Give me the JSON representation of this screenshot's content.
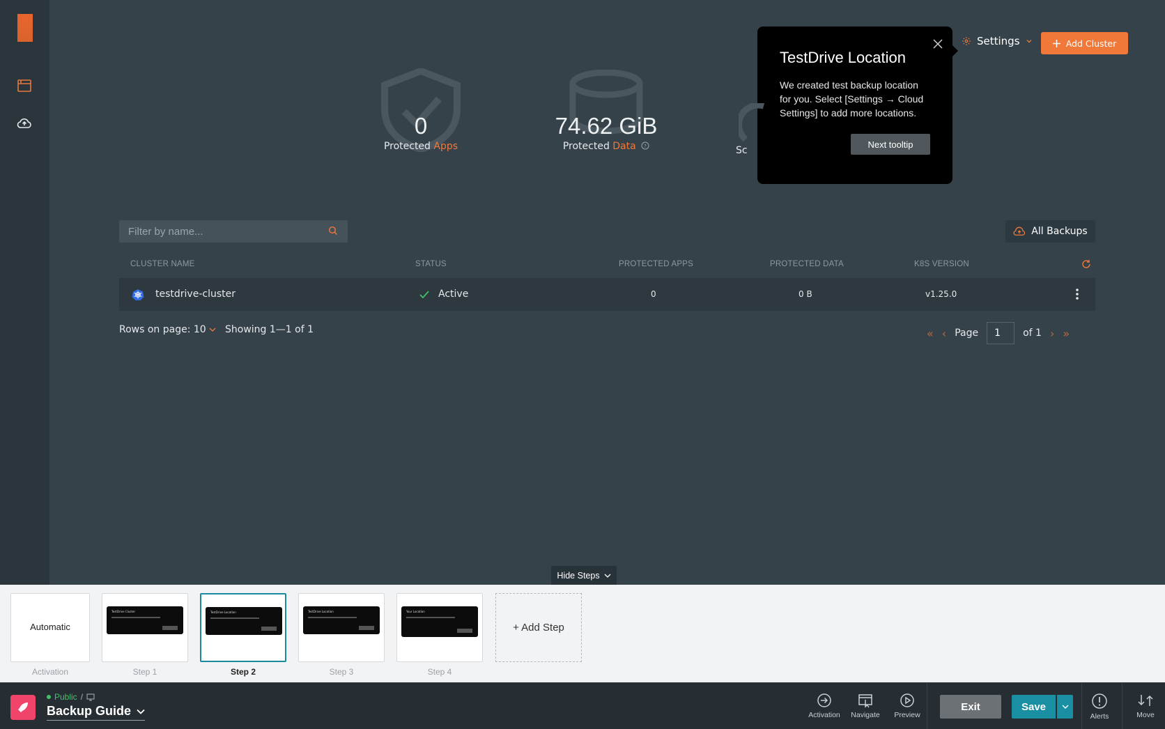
{
  "header": {
    "settings_label": "Settings",
    "add_cluster_label": "Add Cluster"
  },
  "stats": {
    "apps": {
      "value": "0",
      "label": "Protected",
      "accent": "Apps"
    },
    "data": {
      "value": "74.62 GiB",
      "label": "Protected",
      "accent": "Data"
    },
    "third_partial": "Sc"
  },
  "tooltip": {
    "title": "TestDrive Location",
    "body": "We created test backup location for you. Select [Settings → Cloud Settings] to add more locations.",
    "next_label": "Next tooltip"
  },
  "filter": {
    "placeholder": "Filter by name..."
  },
  "all_backups_label": "All Backups",
  "table": {
    "headers": [
      "CLUSTER NAME",
      "STATUS",
      "PROTECTED APPS",
      "PROTECTED DATA",
      "K8S VERSION"
    ],
    "rows": [
      {
        "name": "testdrive-cluster",
        "status": "Active",
        "apps": "0",
        "data": "0 B",
        "version": "v1.25.0"
      }
    ]
  },
  "pagination": {
    "rows_label": "Rows on page: 10",
    "showing": "Showing 1—1 of 1",
    "page_label": "Page",
    "page_value": "1",
    "of_label": "of 1"
  },
  "hide_steps_label": "Hide Steps",
  "steps": {
    "activation_card": "Automatic",
    "activation_label": "Activation",
    "items": [
      {
        "label": "Step 1",
        "mini_title": "TestDrive Cluster"
      },
      {
        "label": "Step 2",
        "mini_title": "TestDrive Location"
      },
      {
        "label": "Step 3",
        "mini_title": "TestDrive Location"
      },
      {
        "label": "Step 4",
        "mini_title": "Your Location"
      }
    ],
    "add_step_label": "+ Add Step"
  },
  "bottombar": {
    "visibility": "Public",
    "guide_title": "Backup Guide",
    "tools": [
      "Activation",
      "Navigate",
      "Preview"
    ],
    "exit_label": "Exit",
    "save_label": "Save",
    "alerts_label": "Alerts",
    "move_label": "Move"
  },
  "colors": {
    "accent": "#f0793a",
    "save": "#1a8ea3",
    "public": "#42c36b"
  }
}
